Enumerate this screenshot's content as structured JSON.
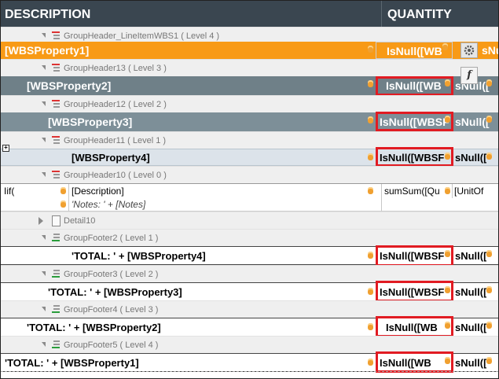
{
  "header": {
    "description": "DESCRIPTION",
    "quantity": "QUANTITY"
  },
  "bands": {
    "gh_line": "GroupHeader_LineItemWBS1 ( Level 4 )",
    "gh13": "GroupHeader13 ( Level 3 )",
    "gh12": "GroupHeader12 ( Level 2 )",
    "gh11": "GroupHeader11 ( Level 1 )",
    "gh10": "GroupHeader10 ( Level 0 )",
    "detail": "Detail10",
    "gf2": "GroupFooter2 ( Level 1 )",
    "gf3": "GroupFooter3 ( Level 2 )",
    "gf4": "GroupFooter4 ( Level 3 )",
    "gf5": "GroupFooter5 ( Level 4 )"
  },
  "rows": {
    "wbs1": "[WBSProperty1]",
    "wbs2": "[WBSProperty2]",
    "wbs3": "[WBSProperty3]",
    "wbs4": "[WBSProperty4]",
    "iif": "Iif(",
    "description": "[Description]",
    "notes": "'Notes: ' + [Notes]",
    "sum": "sumSum([Qu",
    "unitof": "[UnitOf",
    "total4": "'TOTAL: ' + [WBSProperty4]",
    "total3": "'TOTAL: ' + [WBSProperty3]",
    "total2": "'TOTAL: ' + [WBSProperty2]",
    "total1": "'TOTAL: ' + [WBSProperty1]"
  },
  "qty": {
    "r1": "IsNull([WB",
    "r2": "IsNull([WB",
    "r3": "IsNull([WBSF",
    "r4": "IsNull([WBSF",
    "f4": "IsNull([WBSF",
    "f3": "IsNull([WBSF",
    "f2": "IsNull([WB",
    "f1": "IsNull([WB",
    "tail": "sNull(["
  },
  "smarttag": {
    "fx": "f"
  },
  "colors": {
    "orange": "#f89a16",
    "dark": "#6f8088",
    "light": "#dce3ea",
    "red": "#e11b22",
    "header": "#3a4650"
  }
}
